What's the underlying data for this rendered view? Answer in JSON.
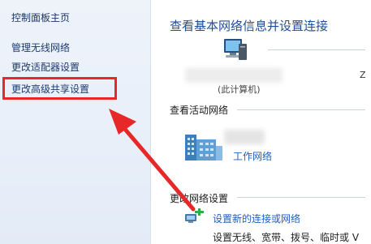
{
  "sidebar": {
    "home_label": "控制面板主页",
    "items": [
      {
        "label": "管理无线网络"
      },
      {
        "label": "更改适配器设置"
      },
      {
        "label": "更改高级共享设置"
      }
    ]
  },
  "main": {
    "title": "查看基本网络信息并设置连接",
    "computer_name_partial": "(此计算机)",
    "edge_char": "Z",
    "active_networks_label": "查看活动网络",
    "network_type_link": "工作网络",
    "change_settings_label": "更改网络设置",
    "setup_connection_link": "设置新的连接或网络",
    "setup_connection_desc": "设置无线、宽带、拨号、临时或 V"
  },
  "colors": {
    "link": "#1f5fbf",
    "title": "#1f4e9a",
    "highlight": "#e62828"
  }
}
